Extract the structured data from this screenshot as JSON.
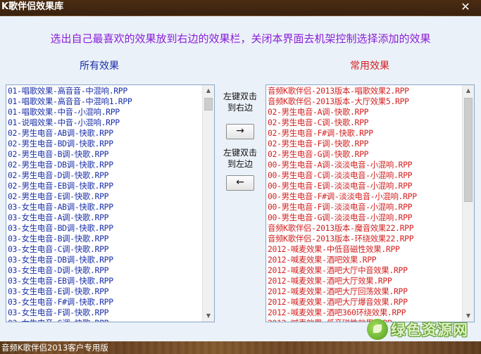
{
  "window": {
    "title": "K歌伴侣效果库",
    "close_glyph": "✕"
  },
  "instruction": "选出自己最喜欢的效果放到右边的效果栏，关闭本界面去机架控制选择添加的效果",
  "left_panel": {
    "title": "所有效果",
    "items": [
      "01-唱歌效果-高音音-中混响.RPP",
      "01-唱歌效果-高音音-中混响1.RPP",
      "01-唱歌效果-中音-小混响.RPP",
      "01-说唱效果-中音-小混响.RPP",
      "02-男生电音-AB调-快歌.RPP",
      "02-男生电音-BD调-快歌.RPP",
      "02-男生电音-B调-快歌.RPP",
      "02-男生电音-DB调-快歌.RPP",
      "02-男生电音-D调-快歌.RPP",
      "02-男生电音-EB调-快歌.RPP",
      "02-男生电音-E调-快歌.RPP",
      "03-女生电音-AB调-快歌.RPP",
      "03-女生电音-A调-快歌.RPP",
      "03-女生电音-BD调-快歌.RPP",
      "03-女生电音-B调-快歌.RPP",
      "03-女生电音-C调-快歌.RPP",
      "03-女生电音-DB调-快歌.RPP",
      "03-女生电音-D调-快歌.RPP",
      "03-女生电音-EB调-快歌.RPP",
      "03-女生电音-E调-快歌.RPP",
      "03-女生电音-F#调-快歌.RPP",
      "03-女生电音-F调-快歌.RPP",
      "03-女生电音-G调-快歌.RPP"
    ]
  },
  "right_panel": {
    "title": "常用效果",
    "items": [
      "音频K歌伴侣-2013版本-唱歌效果2.RPP",
      "音频K歌伴侣-2013版本-大厅效果5.RPP",
      "02-男生电音-A调-快歌.RPP",
      "02-男生电音-C调-快歌.RPP",
      "02-男生电音-F#调-快歌.RPP",
      "02-男生电音-F调-快歌.RPP",
      "02-男生电音-G调-快歌.RPP",
      "00-男生电音-A调-淡淡电音-小混响.RPP",
      "00-男生电音-C调-淡淡电音-小混响.RPP",
      "00-男生电音-E调-淡淡电音-小混响.RPP",
      "00-男生电音-F#调-淡淡电音-小混响.RPP",
      "00-男生电音-F调-淡淡电音-小混响.RPP",
      "00-男生电音-G调-淡淡电音-小混响.RPP",
      "音频K歌伴侣-2013版本-魔音效果22.RPP",
      "音频K歌伴侣-2013版本-环绕效果22.RPP",
      "2012-喊麦效果-中低音磁性效果.RPP",
      "2012-喊麦效果-酒吧效果.RPP",
      "2012-喊麦效果-酒吧大厅中音效果.RPP",
      "2012-喊麦效果-酒吧大厅效果.RPP",
      "2012-喊麦效果-酒吧大厅回荡效果.RPP",
      "2012-喊麦效果-酒吧大厅爆音效果.RPP",
      "2012-喊麦效果-酒吧360环绕效果.RPP",
      "2012-喊麦效果-低音磁性效果.RPP"
    ]
  },
  "middle": {
    "add_label_line1": "左键双击",
    "add_label_line2": "到右边",
    "add_button": "→",
    "remove_label_line1": "左键双击",
    "remove_label_line2": "到左边",
    "remove_button": "←"
  },
  "scrollbar": {
    "up_glyph": "▲",
    "down_glyph": "▼"
  },
  "status_bar": {
    "text": "音频K歌伴侣2013客户专用版"
  },
  "watermark": {
    "text": "绿色资源网"
  },
  "colors": {
    "instruction": "#8b1fd6",
    "left_list_text": "#1a2fa8",
    "right_list_text": "#d42020",
    "panel_background": "#eaf1f9"
  }
}
